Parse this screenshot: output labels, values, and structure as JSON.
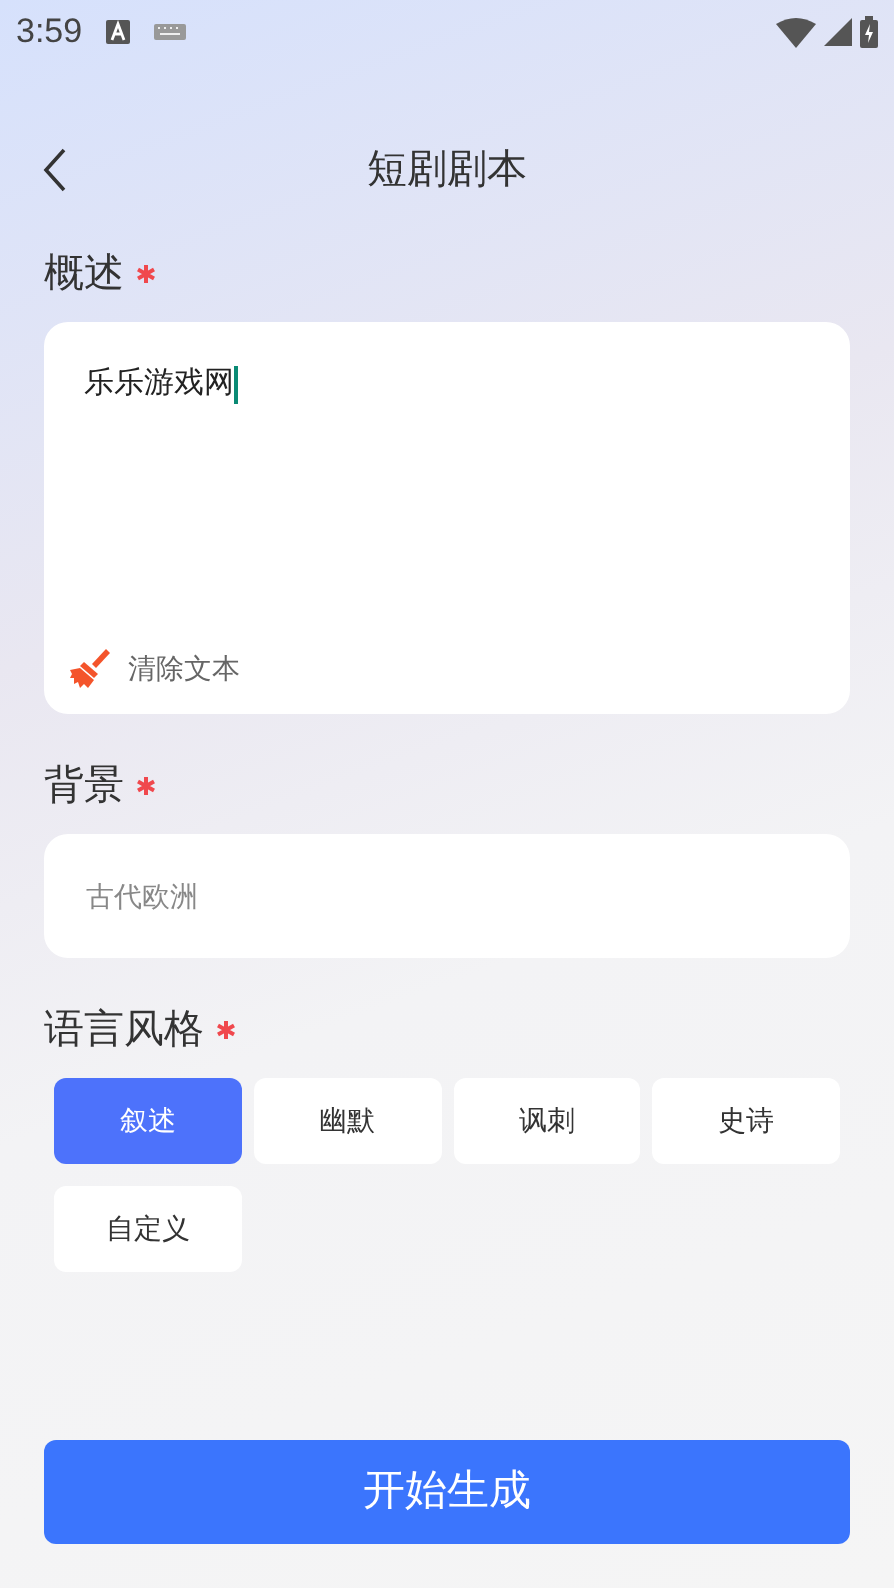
{
  "status_bar": {
    "time": "3:59"
  },
  "header": {
    "title": "短剧剧本"
  },
  "overview": {
    "label": "概述",
    "required": true,
    "value": "乐乐游戏网",
    "clear_label": "清除文本"
  },
  "background": {
    "label": "背景",
    "required": true,
    "placeholder": "古代欧洲"
  },
  "style": {
    "label": "语言风格",
    "required": true,
    "options": [
      {
        "label": "叙述",
        "selected": true
      },
      {
        "label": "幽默",
        "selected": false
      },
      {
        "label": "讽刺",
        "selected": false
      },
      {
        "label": "史诗",
        "selected": false
      },
      {
        "label": "自定义",
        "selected": false
      }
    ]
  },
  "submit_button": {
    "label": "开始生成"
  }
}
